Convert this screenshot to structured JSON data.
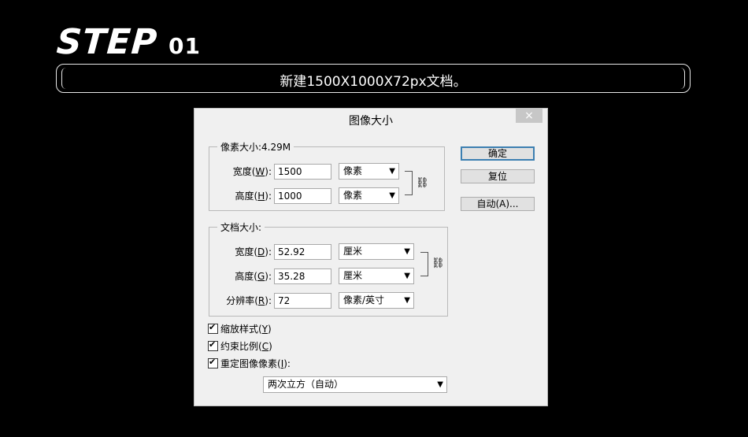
{
  "heading": {
    "step": "STEP",
    "number": "01"
  },
  "banner": {
    "text": "新建1500X1000X72px文档。"
  },
  "dialog": {
    "title": "图像大小",
    "close": "×",
    "pixel_group": {
      "legend": "像素大小:4.29M",
      "width_label": "宽度(",
      "width_key": "W",
      "width_label_end": "):",
      "width_value": "1500",
      "width_unit": "像素",
      "height_label": "高度(",
      "height_key": "H",
      "height_label_end": "):",
      "height_value": "1000",
      "height_unit": "像素"
    },
    "doc_group": {
      "legend": "文档大小:",
      "width_label": "宽度(",
      "width_key": "D",
      "width_label_end": "):",
      "width_value": "52.92",
      "width_unit": "厘米",
      "height_label": "高度(",
      "height_key": "G",
      "height_label_end": "):",
      "height_value": "35.28",
      "height_unit": "厘米",
      "res_label": "分辨率(",
      "res_key": "R",
      "res_label_end": "):",
      "res_value": "72",
      "res_unit": "像素/英寸"
    },
    "buttons": {
      "ok": "确定",
      "reset": "复位",
      "auto": "自动(A)..."
    },
    "checkboxes": [
      {
        "label": "缩放样式(",
        "key": "Y",
        "end": ")",
        "checked": true
      },
      {
        "label": "约束比例(",
        "key": "C",
        "end": ")",
        "checked": true
      },
      {
        "label": "重定图像像素(",
        "key": "I",
        "end": "):",
        "checked": true
      }
    ],
    "resample_method": "两次立方（自动）"
  }
}
